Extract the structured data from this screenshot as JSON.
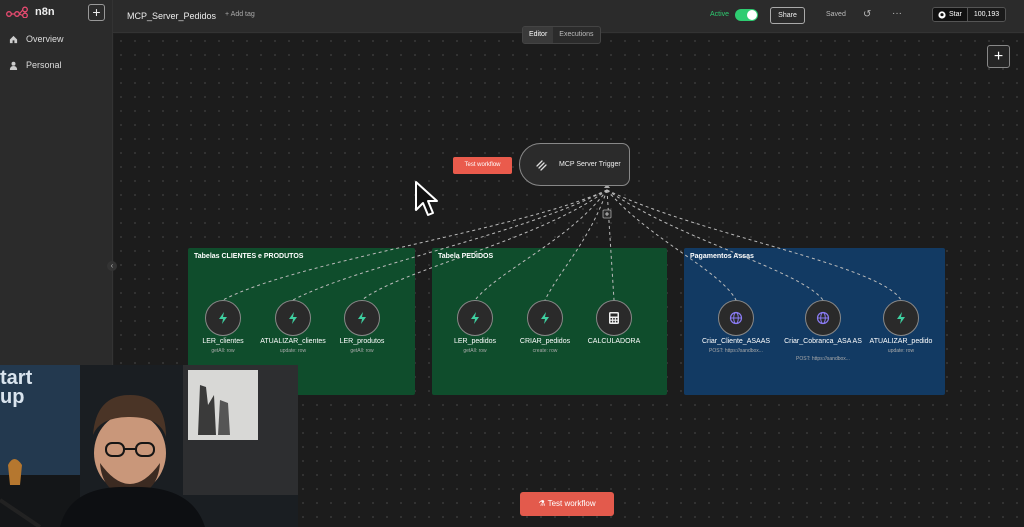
{
  "app": {
    "name": "n8n"
  },
  "sidebar": {
    "items": [
      {
        "label": "Overview",
        "icon": "home-icon"
      },
      {
        "label": "Personal",
        "icon": "user-icon"
      }
    ]
  },
  "header": {
    "workflow_title": "MCP_Server_Pedidos",
    "add_tag": "+ Add tag",
    "active_label": "Active",
    "share_label": "Share",
    "saved_label": "Saved",
    "star_label": "Star",
    "star_count": "100,193"
  },
  "tabs": [
    {
      "label": "Editor",
      "active": true
    },
    {
      "label": "Executions",
      "active": false
    }
  ],
  "canvas": {
    "test_workflow_small": "Test workflow",
    "test_workflow_button": "Test workflow",
    "trigger": {
      "label": "MCP Server Trigger"
    },
    "groups": [
      {
        "title": "Tabelas CLIENTES e PRODUTOS",
        "color": "#0f4d2c"
      },
      {
        "title": "Tabela PEDIDOS",
        "color": "#0f4d2c"
      },
      {
        "title": "Pagamentos Assas",
        "color": "#123a63"
      }
    ],
    "nodes": [
      {
        "label": "LER_clientes",
        "sub": "getAll: row",
        "icon": "bolt-icon"
      },
      {
        "label": "ATUALIZAR_clientes",
        "sub": "update: row",
        "icon": "bolt-icon"
      },
      {
        "label": "LER_produtos",
        "sub": "getAll: row",
        "icon": "bolt-icon"
      },
      {
        "label": "LER_pedidos",
        "sub": "getAll: row",
        "icon": "bolt-icon"
      },
      {
        "label": "CRIAR_pedidos",
        "sub": "create: row",
        "icon": "bolt-icon"
      },
      {
        "label": "CALCULADORA",
        "sub": "",
        "icon": "calculator-icon"
      },
      {
        "label": "Criar_Cliente_ASAAS",
        "sub": "POST: https://sandbox...",
        "icon": "globe-icon"
      },
      {
        "label": "Criar_Cobranca_ASA AS",
        "sub": "POST: https://sandbox...",
        "icon": "globe-icon"
      },
      {
        "label": "ATUALIZAR_pedido",
        "sub": "update: row",
        "icon": "bolt-icon"
      }
    ]
  },
  "webcam": {
    "sign_text": "tart up"
  },
  "colors": {
    "accent": "#ea5b4c",
    "active": "#2ecc71",
    "bolt": "#3ecfa0",
    "globe": "#8b7cf6"
  }
}
